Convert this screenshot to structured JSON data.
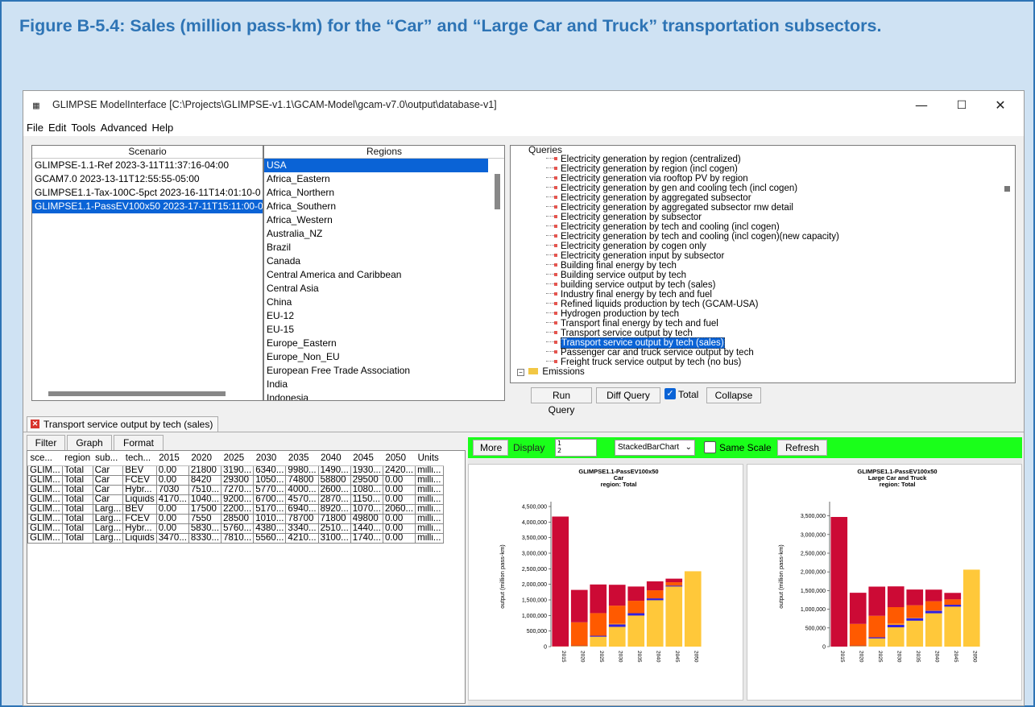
{
  "figure_title": "Figure B-5.4: Sales (million pass-km) for the “Car” and “Large Car and Truck” transportation subsectors.",
  "window": {
    "title": "GLIMPSE ModelInterface [C:\\Projects\\GLIMPSE-v1.1\\GCAM-Model\\gcam-v7.0\\output\\database-v1]",
    "minimize": "—",
    "maximize": "☐",
    "close": "✕"
  },
  "menu": [
    "File",
    "Edit",
    "Tools",
    "Advanced",
    "Help"
  ],
  "scenario": {
    "header": "Scenario",
    "items": [
      "GLIMPSE-1.1-Ref 2023-3-11T11:37:16-04:00",
      "GCAM7.0 2023-13-11T12:55:55-05:00",
      "GLIMPSE1.1-Tax-100C-5pct 2023-16-11T14:01:10-0",
      "GLIMPSE1.1-PassEV100x50 2023-17-11T15:11:00-0"
    ],
    "selected_index": 3
  },
  "regions": {
    "header": "Regions",
    "items": [
      "USA",
      "Africa_Eastern",
      "Africa_Northern",
      "Africa_Southern",
      "Africa_Western",
      "Australia_NZ",
      "Brazil",
      "Canada",
      "Central America and Caribbean",
      "Central Asia",
      "China",
      "EU-12",
      "EU-15",
      "Europe_Eastern",
      "Europe_Non_EU",
      "European Free Trade Association",
      "India",
      "Indonesia"
    ],
    "selected_index": 0
  },
  "queries": {
    "header": "Queries",
    "items": [
      "Electricity generation by region (centralized)",
      "Electricity generation by region (incl cogen)",
      "Electricity generation via rooftop PV by region",
      "Electricity generation by gen and cooling tech (incl cogen)",
      "Electricity generation by aggregated subsector",
      "Electricity generation by aggregated subsector rnw detail",
      "Electricity generation by subsector",
      "Electricity generation by tech and cooling (incl cogen)",
      "Electricity generation by tech and cooling (incl cogen)(new capacity)",
      "Electricity generation by cogen only",
      "Electricity generation input by subsector",
      "Building final energy by tech",
      "Building service output by tech",
      "building service output by tech (sales)",
      "Industry final energy by tech and fuel",
      "Refined liquids production by tech (GCAM-USA)",
      "Hydrogen production by tech",
      "Transport final energy by tech and fuel",
      "Transport service output by tech",
      "Transport service output by tech (sales)",
      "Passenger car and truck service output by tech",
      "Freight truck service output by tech (no bus)"
    ],
    "selected_index": 19,
    "folder": "Emissions",
    "buttons": {
      "run": "Run Query",
      "diff": "Diff Query",
      "total": "Total",
      "collapse": "Collapse"
    }
  },
  "result_tab": "Transport service output by tech (sales)",
  "subtabs": [
    "Filter",
    "Graph",
    "Format"
  ],
  "table": {
    "headers": [
      "sce...",
      "region",
      "sub...",
      "tech...",
      "2015",
      "2020",
      "2025",
      "2030",
      "2035",
      "2040",
      "2045",
      "2050",
      "Units"
    ],
    "rows": [
      [
        "GLIM...",
        "Total",
        "Car",
        "BEV",
        "0.00",
        "21800",
        "3190...",
        "6340...",
        "9980...",
        "1490...",
        "1930...",
        "2420...",
        "milli..."
      ],
      [
        "GLIM...",
        "Total",
        "Car",
        "FCEV",
        "0.00",
        "8420",
        "29300",
        "1050...",
        "74800",
        "58800",
        "29500",
        "0.00",
        "milli..."
      ],
      [
        "GLIM...",
        "Total",
        "Car",
        "Hybr...",
        "7030",
        "7510...",
        "7270...",
        "5770...",
        "4000...",
        "2600...",
        "1080...",
        "0.00",
        "milli..."
      ],
      [
        "GLIM...",
        "Total",
        "Car",
        "Liquids",
        "4170...",
        "1040...",
        "9200...",
        "6700...",
        "4570...",
        "2870...",
        "1150...",
        "0.00",
        "milli..."
      ],
      [
        "GLIM...",
        "Total",
        "Larg...",
        "BEV",
        "0.00",
        "17500",
        "2200...",
        "5170...",
        "6940...",
        "8920...",
        "1070...",
        "2060...",
        "milli..."
      ],
      [
        "GLIM...",
        "Total",
        "Larg...",
        "FCEV",
        "0.00",
        "7550",
        "28500",
        "1010...",
        "78700",
        "71800",
        "49800",
        "0.00",
        "milli..."
      ],
      [
        "GLIM...",
        "Total",
        "Larg...",
        "Hybr...",
        "0.00",
        "5830...",
        "5760...",
        "4380...",
        "3340...",
        "2510...",
        "1440...",
        "0.00",
        "milli..."
      ],
      [
        "GLIM...",
        "Total",
        "Larg...",
        "Liquids",
        "3470...",
        "8330...",
        "7810...",
        "5560...",
        "4210...",
        "3100...",
        "1740...",
        "0.00",
        "milli..."
      ]
    ]
  },
  "graph_toolbar": {
    "more": "More",
    "display_label": "Display",
    "display_values": [
      "1",
      "2"
    ],
    "chart_type": "StackedBarChart",
    "same_scale": "Same Scale",
    "refresh": "Refresh"
  },
  "colors": {
    "accent_select": "#0a63d6",
    "green_bar": "#1aff1a",
    "liquids": "#cc0a35",
    "hybrid": "#ff5a00",
    "fcev": "#ff9a1a",
    "fcev_line": "#3020e0",
    "bev": "#ffc83a"
  },
  "chart_data": [
    {
      "type": "bar",
      "stacked": true,
      "title": "GLIMPSE1.1-PassEV100x50",
      "subtitle": [
        "Car",
        "region: Total"
      ],
      "ylabel": "output (million pass-km)",
      "categories": [
        "2015",
        "2020",
        "2025",
        "2030",
        "2035",
        "2040",
        "2045",
        "2050"
      ],
      "ylim": [
        0,
        4500000
      ],
      "yticks": [
        "0",
        "500,000",
        "1,000,000",
        "1,500,000",
        "2,000,000",
        "2,500,000",
        "3,000,000",
        "3,500,000",
        "4,000,000",
        "4,500,000"
      ],
      "ytick_values": [
        0,
        500000,
        1000000,
        1500000,
        2000000,
        2500000,
        3000000,
        3500000,
        4000000,
        4500000
      ],
      "series": [
        {
          "key": "bev",
          "values": [
            0,
            21800,
            319000,
            634000,
            998000,
            1490000,
            1930000,
            2420000
          ]
        },
        {
          "key": "fcev",
          "values": [
            0,
            8420,
            29300,
            105000,
            74800,
            58800,
            29500,
            0
          ]
        },
        {
          "key": "hybrid",
          "values": [
            7030,
            751000,
            727000,
            577000,
            400000,
            260000,
            108000,
            0
          ]
        },
        {
          "key": "liquids",
          "values": [
            4170000,
            1040000,
            920000,
            670000,
            457000,
            287000,
            115000,
            0
          ]
        }
      ]
    },
    {
      "type": "bar",
      "stacked": true,
      "title": "GLIMPSE1.1-PassEV100x50",
      "subtitle": [
        "Large Car and Truck",
        "region: Total"
      ],
      "ylabel": "output (million pass-km)",
      "categories": [
        "2015",
        "2020",
        "2025",
        "2030",
        "2035",
        "2040",
        "2045",
        "2050"
      ],
      "ylim": [
        0,
        3750000
      ],
      "yticks": [
        "0",
        "500,000",
        "1,000,000",
        "1,500,000",
        "2,000,000",
        "2,500,000",
        "3,000,000",
        "3,500,000"
      ],
      "ytick_values": [
        0,
        500000,
        1000000,
        1500000,
        2000000,
        2500000,
        3000000,
        3500000
      ],
      "series": [
        {
          "key": "bev",
          "values": [
            0,
            17500,
            220000,
            517000,
            694000,
            892000,
            1070000,
            2060000
          ]
        },
        {
          "key": "fcev",
          "values": [
            0,
            7550,
            28500,
            101000,
            78700,
            71800,
            49800,
            0
          ]
        },
        {
          "key": "hybrid",
          "values": [
            0,
            583000,
            576000,
            438000,
            334000,
            251000,
            144000,
            0
          ]
        },
        {
          "key": "liquids",
          "values": [
            3470000,
            833000,
            781000,
            556000,
            421000,
            310000,
            174000,
            0
          ]
        }
      ]
    }
  ]
}
